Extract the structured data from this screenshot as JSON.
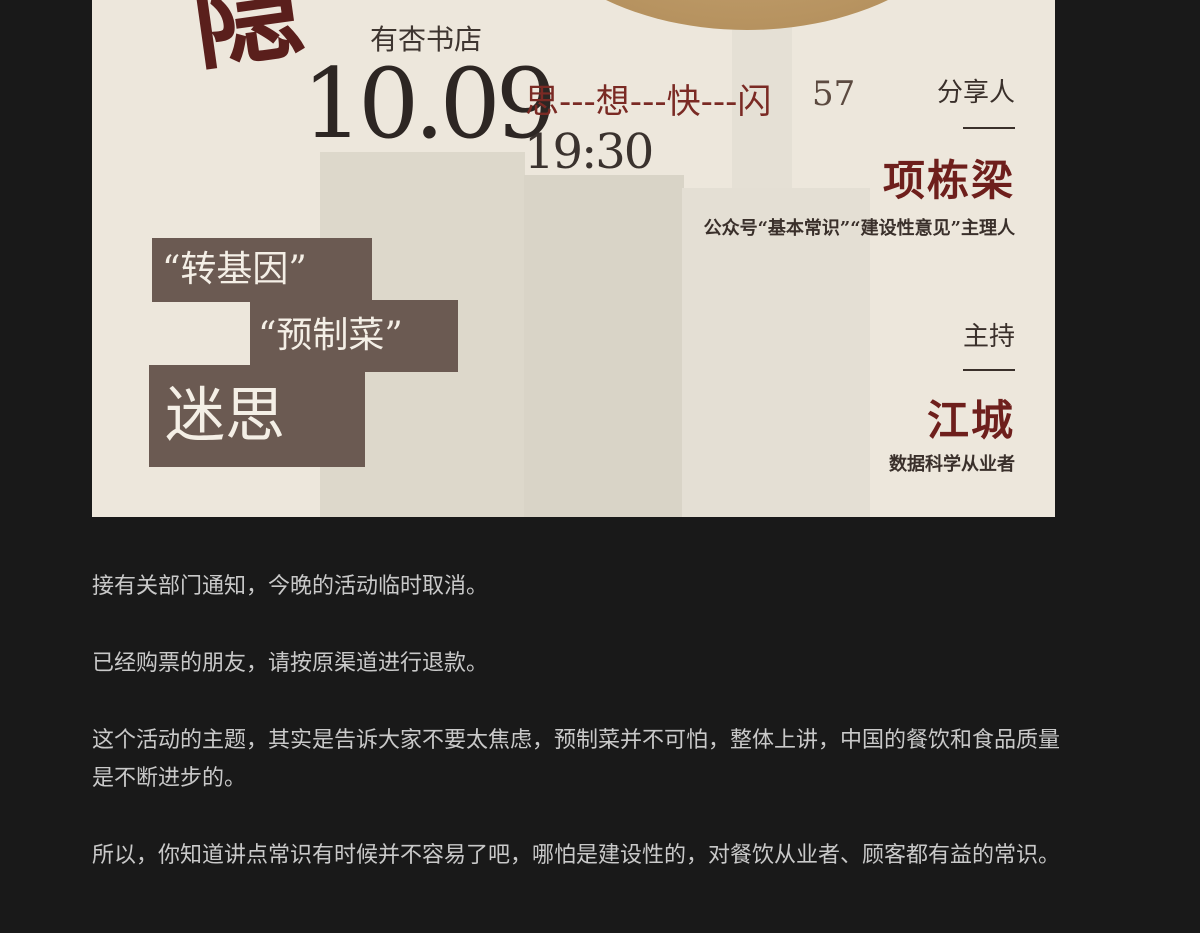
{
  "poster": {
    "logo_glyph": "隐",
    "store": "有杏书店",
    "date": "10.09",
    "series": "思---想---快---闪",
    "episode": "57",
    "time": "19:30",
    "speaker_role": "分享人",
    "speaker_name": "项栋梁",
    "speaker_desc": "公众号“基本常识”“建设性意见”主理人",
    "host_role": "主持",
    "host_name": "江城",
    "host_desc": "数据科学从业者",
    "tags": [
      "“转基因”",
      "“预制菜”",
      "迷思"
    ],
    "colors": {
      "accent": "#6e1f1c",
      "tag_bg": "#6b5a52",
      "poster_bg": "#ede7dc"
    }
  },
  "article": {
    "paragraphs": [
      "接有关部门通知，今晚的活动临时取消。",
      "已经购票的朋友，请按原渠道进行退款。",
      "这个活动的主题，其实是告诉大家不要太焦虑，预制菜并不可怕，整体上讲，中国的餐饮和食品质量是不断进步的。",
      "所以，你知道讲点常识有时候并不容易了吧，哪怕是建设性的，对餐饮从业者、顾客都有益的常识。"
    ]
  }
}
